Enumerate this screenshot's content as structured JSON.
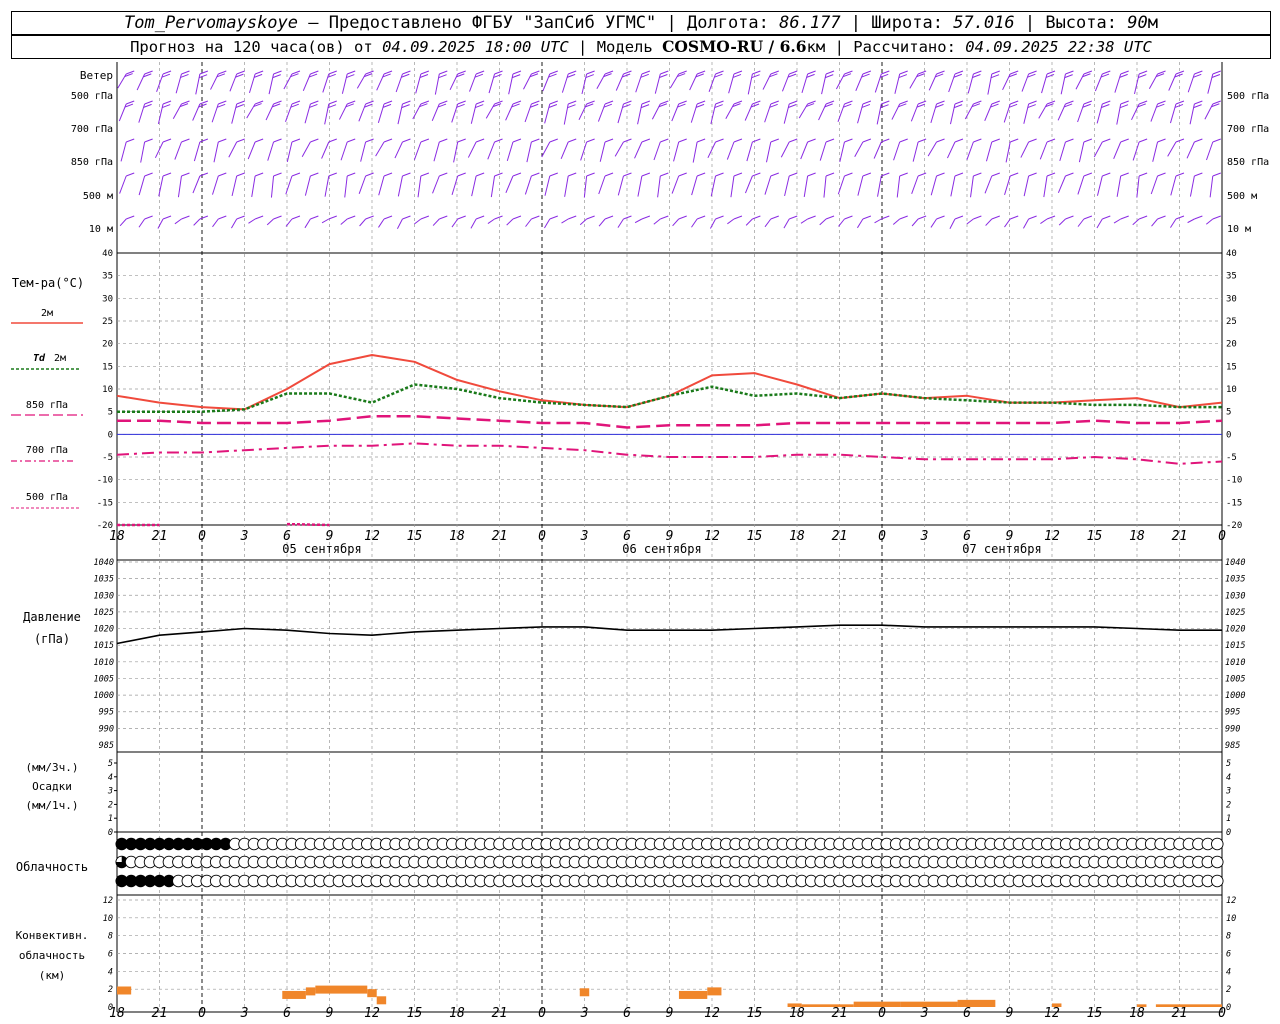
{
  "header": {
    "station": "Tom_Pervomayskoye",
    "dash": "–",
    "provider": "Предоставлено ФГБУ \"ЗапСиб УГМС\"",
    "lon_label": "Долгота:",
    "lon_value": "86.177",
    "lat_label": "Широта:",
    "lat_value": "57.016",
    "alt_label": "Высота:",
    "alt_value": "90",
    "alt_unit": "м",
    "forecast_prefix": "Прогноз на 120 часа(ов) от",
    "forecast_start": "04.09.2025 18:00 UTC",
    "model_label": "Модель",
    "model_name": "COSMO-RU / 6.6",
    "model_unit": "км",
    "calc_label": "Рассчитано:",
    "calc_time": "04.09.2025 22:38 UTC"
  },
  "colors": {
    "wind": "#8a2be2",
    "t2m": "#f04a3c",
    "td2m": "#1a7a1a",
    "t850": "#e0147a",
    "t700": "#e0147a",
    "t500": "#e0147a",
    "pressure": "#000000",
    "convective": "#f0862a",
    "zero_line": "#2b2bd8",
    "grid": "#9a9a9a"
  },
  "labels": {
    "wind_title": "Ветер",
    "wind_levels": [
      "500 гПа",
      "700 гПа",
      "850 гПа",
      "500 м",
      "10  м"
    ],
    "temp_title": "Тем-ра(°C)",
    "legend_2m": "2м",
    "legend_td": "Td",
    "legend_td_unit": "2м",
    "legend_850": "850 гПа",
    "legend_700": "700 гПа",
    "legend_500": "500 гПа",
    "pressure_title": "Давление",
    "pressure_unit": "(гПа)",
    "precip_unit_top": "(мм/3ч.)",
    "precip_title": "Осадки",
    "precip_unit_bottom": "(мм/1ч.)",
    "cloud_title": "Облачность",
    "conv_title_1": "Конвективн.",
    "conv_title_2": "облачность",
    "conv_title_3": "(км)"
  },
  "chart_data": [
    {
      "type": "line",
      "name": "temperature",
      "x_ticks": [
        "18",
        "21",
        "0",
        "3",
        "6",
        "9",
        "12",
        "15",
        "18",
        "21",
        "0",
        "3",
        "6",
        "9",
        "12",
        "15",
        "18",
        "21",
        "0",
        "3",
        "6",
        "9",
        "12",
        "15",
        "18",
        "21",
        "0"
      ],
      "day_labels": [
        "05 сентября",
        "06 сентября",
        "07 сентября"
      ],
      "ylim": [
        -20,
        40
      ],
      "yticks": [
        -20,
        -15,
        -10,
        -5,
        0,
        5,
        10,
        15,
        20,
        25,
        30,
        35,
        40
      ],
      "x_hours": [
        0,
        3,
        6,
        9,
        12,
        15,
        18,
        21,
        24,
        27,
        30,
        33,
        36,
        39,
        42,
        45,
        48,
        51,
        54,
        57,
        60,
        63,
        66,
        69,
        72,
        75,
        78
      ],
      "series": [
        {
          "name": "2м",
          "values": [
            8.5,
            7,
            6,
            5.5,
            10,
            15.5,
            17.5,
            16,
            12,
            9.5,
            7.5,
            6.5,
            6,
            8.5,
            13,
            13.5,
            11,
            8,
            9,
            8,
            8.5,
            7,
            7,
            7.5,
            8,
            6,
            7
          ]
        },
        {
          "name": "Td 2м",
          "values": [
            5,
            5,
            5,
            5.5,
            9,
            9,
            7,
            11,
            10,
            8,
            7,
            6.5,
            6,
            8.5,
            10.5,
            8.5,
            9,
            8,
            9,
            8,
            7.5,
            7,
            7,
            6.5,
            6.5,
            6,
            6
          ]
        },
        {
          "name": "850 гПа",
          "values": [
            3,
            3,
            2.5,
            2.5,
            2.5,
            3,
            4,
            4,
            3.5,
            3,
            2.5,
            2.5,
            1.5,
            2,
            2,
            2,
            2.5,
            2.5,
            2.5,
            2.5,
            2.5,
            2.5,
            2.5,
            3,
            2.5,
            2.5,
            3
          ]
        },
        {
          "name": "700 гПа",
          "values": [
            -4.5,
            -4,
            -4,
            -3.5,
            -3,
            -2.5,
            -2.5,
            -2,
            -2.5,
            -2.5,
            -3,
            -3.5,
            -4.5,
            -5,
            -5,
            -5,
            -4.5,
            -4.5,
            -5,
            -5.5,
            -5.5,
            -5.5,
            -5.5,
            -5,
            -5.5,
            -6.5,
            -6
          ]
        },
        {
          "name": "500 гПа",
          "values": [
            -20,
            -20,
            null,
            null,
            -19.8,
            -20,
            null,
            null,
            null,
            null,
            null,
            null,
            null,
            null,
            null,
            null,
            null,
            null,
            null,
            null,
            null,
            null,
            null,
            null,
            null,
            null,
            null
          ]
        }
      ]
    },
    {
      "type": "line",
      "name": "pressure",
      "ylim": [
        985,
        1040
      ],
      "yticks": [
        985,
        990,
        995,
        1000,
        1005,
        1010,
        1015,
        1020,
        1025,
        1030,
        1035,
        1040
      ],
      "x_hours": [
        0,
        3,
        6,
        9,
        12,
        15,
        18,
        21,
        24,
        27,
        30,
        33,
        36,
        39,
        42,
        45,
        48,
        51,
        54,
        57,
        60,
        63,
        66,
        69,
        72,
        75,
        78
      ],
      "series": [
        {
          "name": "Давление",
          "values": [
            1015.5,
            1018,
            1019,
            1020,
            1019.5,
            1018.5,
            1018,
            1019,
            1019.5,
            1020,
            1020.5,
            1020.5,
            1019.5,
            1019.5,
            1019.5,
            1020,
            1020.5,
            1021,
            1021,
            1020.5,
            1020.5,
            1020.5,
            1020.5,
            1020.5,
            1020,
            1019.5,
            1019.5
          ]
        }
      ]
    },
    {
      "type": "bar",
      "name": "precipitation",
      "ylim": [
        0,
        5
      ],
      "yticks": [
        0,
        1,
        2,
        3,
        4,
        5
      ],
      "values": []
    },
    {
      "type": "bar",
      "name": "convective_cloud",
      "ylim": [
        0,
        12
      ],
      "yticks": [
        0,
        2,
        4,
        6,
        8,
        10,
        12
      ],
      "bars": [
        {
          "x0": 0,
          "x1": 1.5,
          "value": 2.3
        },
        {
          "x0": 17.5,
          "x1": 20,
          "value": 1.8
        },
        {
          "x0": 20,
          "x1": 21,
          "value": 2.2
        },
        {
          "x0": 21,
          "x1": 26.5,
          "value": 2.4
        },
        {
          "x0": 26.5,
          "x1": 27.5,
          "value": 2.0
        },
        {
          "x0": 27.5,
          "x1": 28.5,
          "value": 1.2
        },
        {
          "x0": 49,
          "x1": 50,
          "value": 2.1
        },
        {
          "x0": 59.5,
          "x1": 62.5,
          "value": 1.8
        },
        {
          "x0": 62.5,
          "x1": 64,
          "value": 2.2
        },
        {
          "x0": 71,
          "x1": 72.5,
          "value": 0.4
        },
        {
          "x0": 72.5,
          "x1": 78,
          "value": 0.3
        },
        {
          "x0": 78,
          "x1": 83,
          "value": 0.6
        },
        {
          "x0": 83,
          "x1": 89,
          "value": 0.6
        },
        {
          "x0": 89,
          "x1": 93,
          "value": 0.8
        },
        {
          "x0": 99,
          "x1": 100,
          "value": 0.4
        },
        {
          "x0": 108,
          "x1": 109,
          "value": 0.3
        },
        {
          "x0": 110,
          "x1": 117,
          "value": 0.3
        }
      ]
    },
    {
      "type": "table",
      "name": "cloudiness",
      "rows": [
        "abb8cc8fcbfc000000000000000000000000000000000000000000000000000000000000000000000000000000000000000000000000000000000",
        "6000000000000000000000000000000000000000000000000000000000000000000000000000000000000000000000000000000000000000000000",
        "8abb8c0000000000000000000000000000000000000000000000000000000000000000000000000000000000000000000000000000000000000000"
      ]
    }
  ]
}
